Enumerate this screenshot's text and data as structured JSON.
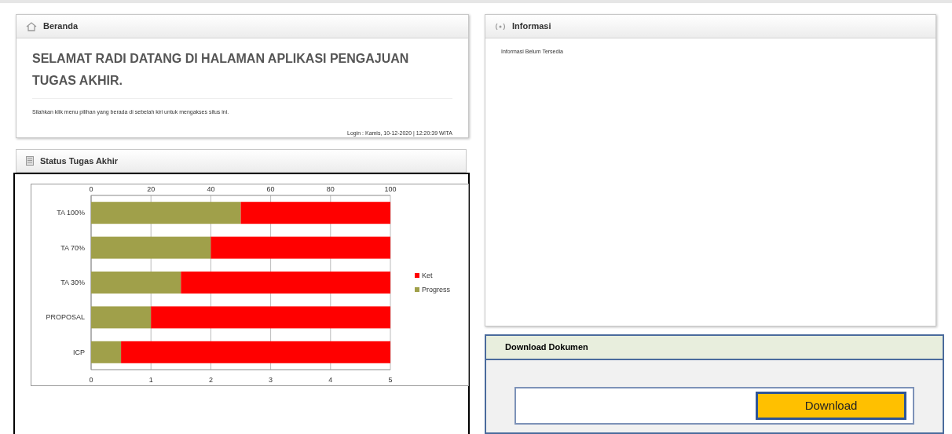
{
  "beranda": {
    "title": "Beranda",
    "heading": "SELAMAT RADI DATANG DI HALAMAN APLIKASI PENGAJUAN TUGAS AKHIR.",
    "instruction": "Silahkan klik menu pilihan yang berada di sebelah kiri untuk mengakses situs ini.",
    "login": "Login : Kamis, 10-12-2020 | 12:20:39 WITA"
  },
  "status": {
    "title": "Status Tugas Akhir",
    "chart_data": {
      "type": "bar",
      "orientation": "horizontal",
      "stacked": true,
      "categories": [
        "TA 100%",
        "TA 70%",
        "TA 30%",
        "PROPOSAL",
        "ICP"
      ],
      "series": [
        {
          "name": "Progress",
          "color": "#a0a04a",
          "values": [
            2.5,
            2,
            1.5,
            1,
            0.5
          ]
        },
        {
          "name": "Ket",
          "color": "#ff0000",
          "values": [
            2.5,
            3,
            3.5,
            4,
            4.5
          ]
        }
      ],
      "xlim": [
        0,
        5
      ],
      "xticks": [
        {
          "value": 0,
          "label": "0"
        },
        {
          "value": 1,
          "label": "1"
        },
        {
          "value": 2,
          "label": "2"
        },
        {
          "value": 3,
          "label": "3"
        },
        {
          "value": 4,
          "label": "4"
        },
        {
          "value": 5,
          "label": "5"
        }
      ],
      "grid": true,
      "legend": true
    },
    "top_axis_labels": [
      "0",
      "20",
      "40",
      "60",
      "80",
      "100"
    ]
  },
  "informasi": {
    "title": "Informasi",
    "text": "Informasi Belum Tersedia"
  },
  "download": {
    "title": "Download Dokumen",
    "button": "Download"
  }
}
